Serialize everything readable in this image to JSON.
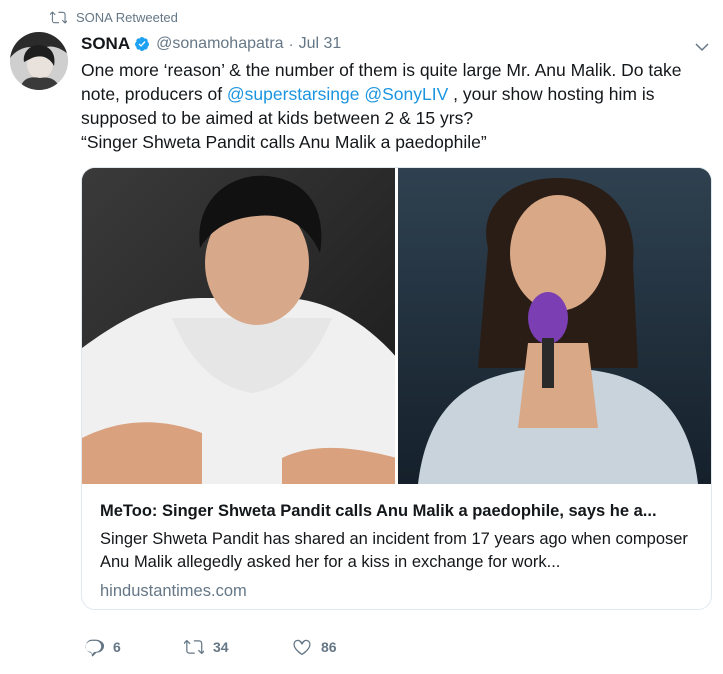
{
  "retweet_context": {
    "label": "SONA Retweeted",
    "icon": "retweet-icon"
  },
  "tweet": {
    "author_name": "SONA",
    "handle": "@sonamohapatra",
    "separator": "·",
    "date": "Jul 31",
    "verified": true,
    "text_part1": "One more ‘reason’ & the number of them is quite large Mr. Anu Malik. Do take note, producers of ",
    "mention1": "@superstarsinge",
    "text_space": " ",
    "mention2": "@SonyLIV",
    "text_part2": " , your show hosting him is supposed to be aimed at kids between 2 & 15 yrs?",
    "text_part3": "“Singer Shweta Pandit calls Anu Malik a paedophile”"
  },
  "card": {
    "title": "MeToo: Singer Shweta Pandit calls Anu Malik a paedophile, says he a...",
    "description": "Singer Shweta Pandit has shared an incident from 17 years ago when composer Anu Malik allegedly asked her for a kiss in exchange for work...",
    "domain": "hindustantimes.com"
  },
  "actions": {
    "reply_count": "6",
    "retweet_count": "34",
    "like_count": "86"
  },
  "colors": {
    "link": "#1b95e0",
    "secondary": "#657786",
    "verified": "#1da1f2",
    "border": "#e1e8ed"
  }
}
